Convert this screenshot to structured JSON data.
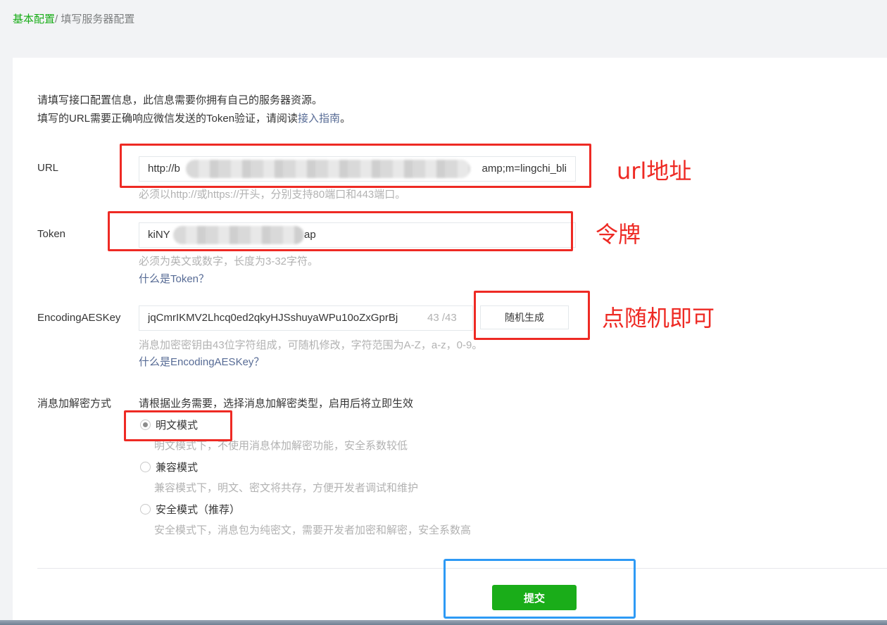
{
  "breadcrumb": {
    "parent": "基本配置",
    "separator": "/",
    "current": "填写服务器配置"
  },
  "intro": {
    "line1": "请填写接口配置信息，此信息需要你拥有自己的服务器资源。",
    "line2_before": "填写的URL需要正确响应微信发送的Token验证，请阅读",
    "line2_link": "接入指南",
    "line2_after": "。"
  },
  "url": {
    "label": "URL",
    "value_start": "http://b",
    "value_end": "amp;m=lingchi_bli",
    "hint": "必须以http://或https://开头，分别支持80端口和443端口。"
  },
  "token": {
    "label": "Token",
    "value_start": "kiNY",
    "value_end": "ap",
    "hint": "必须为英文或数字，长度为3-32字符。",
    "help": "什么是Token？"
  },
  "aes": {
    "label": "EncodingAESKey",
    "value": "jqCmrIKMV2Lhcq0ed2qkyHJSshuyaWPu10oZxGprBj",
    "counter": "43 /43",
    "generate": "随机生成",
    "hint": "消息加密密钥由43位字符组成，可随机修改，字符范围为A-Z，a-z，0-9。",
    "help": "什么是EncodingAESKey？"
  },
  "mode": {
    "label": "消息加解密方式",
    "intro": "请根据业务需要，选择消息加解密类型，启用后将立即生效",
    "options": [
      {
        "label": "明文模式",
        "desc": "明文模式下，不使用消息体加解密功能，安全系数较低",
        "checked": true
      },
      {
        "label": "兼容模式",
        "desc": "兼容模式下，明文、密文将共存，方便开发者调试和维护",
        "checked": false
      },
      {
        "label": "安全模式（推荐）",
        "desc": "安全模式下，消息包为纯密文，需要开发者加密和解密，安全系数高",
        "checked": false
      }
    ]
  },
  "submit": "提交",
  "annotations": {
    "url": "url地址",
    "token": "令牌",
    "random": "点随机即可"
  },
  "colors": {
    "brand_green": "#1aad19",
    "link_blue": "#576b95",
    "annotation_red": "#ee2a24",
    "annotation_blue": "#2e9af5"
  }
}
